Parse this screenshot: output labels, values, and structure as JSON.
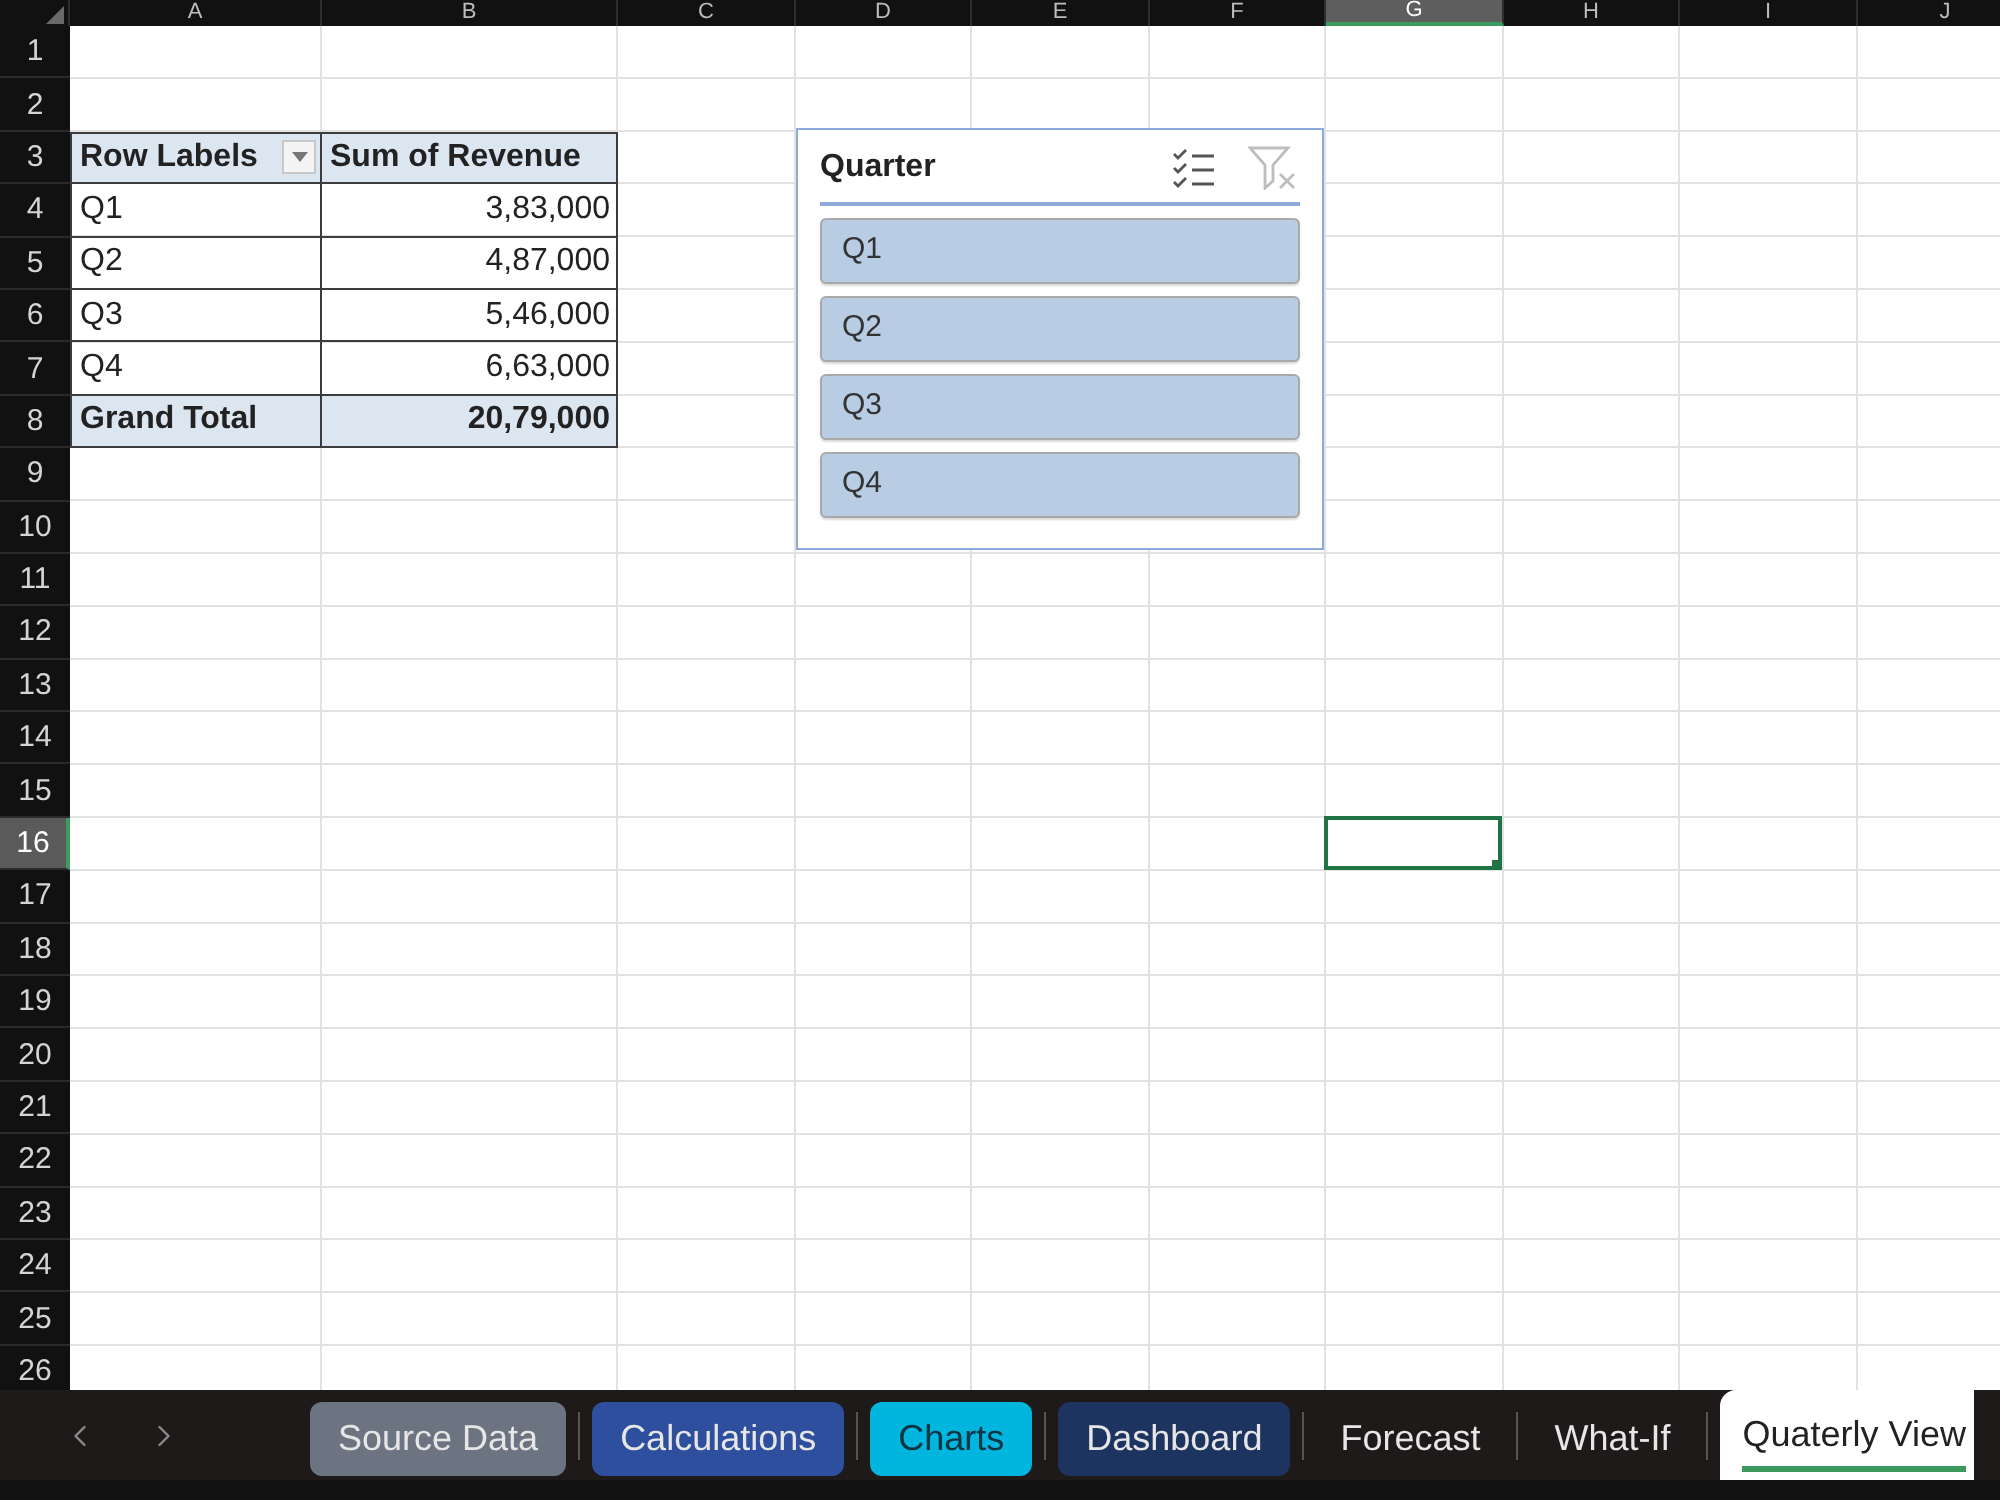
{
  "column_headers": [
    {
      "label": "A",
      "selected": false
    },
    {
      "label": "B",
      "selected": false
    },
    {
      "label": "C",
      "selected": false
    },
    {
      "label": "D",
      "selected": false
    },
    {
      "label": "E",
      "selected": false
    },
    {
      "label": "F",
      "selected": false
    },
    {
      "label": "G",
      "selected": true
    },
    {
      "label": "H",
      "selected": false
    },
    {
      "label": "I",
      "selected": false
    },
    {
      "label": "J",
      "selected": false
    }
  ],
  "row_headers": [
    {
      "label": "1",
      "selected": false
    },
    {
      "label": "2",
      "selected": false
    },
    {
      "label": "3",
      "selected": false
    },
    {
      "label": "4",
      "selected": false
    },
    {
      "label": "5",
      "selected": false
    },
    {
      "label": "6",
      "selected": false
    },
    {
      "label": "7",
      "selected": false
    },
    {
      "label": "8",
      "selected": false
    },
    {
      "label": "9",
      "selected": false
    },
    {
      "label": "10",
      "selected": false
    },
    {
      "label": "11",
      "selected": false
    },
    {
      "label": "12",
      "selected": false
    },
    {
      "label": "13",
      "selected": false
    },
    {
      "label": "14",
      "selected": false
    },
    {
      "label": "15",
      "selected": false
    },
    {
      "label": "16",
      "selected": true
    },
    {
      "label": "17",
      "selected": false
    },
    {
      "label": "18",
      "selected": false
    },
    {
      "label": "19",
      "selected": false
    },
    {
      "label": "20",
      "selected": false
    },
    {
      "label": "21",
      "selected": false
    },
    {
      "label": "22",
      "selected": false
    },
    {
      "label": "23",
      "selected": false
    },
    {
      "label": "24",
      "selected": false
    },
    {
      "label": "25",
      "selected": false
    },
    {
      "label": "26",
      "selected": false
    }
  ],
  "pivot_table": {
    "columns": [
      "Row Labels",
      "Sum of Revenue"
    ],
    "rows": [
      {
        "label": "Q1",
        "value": "3,83,000"
      },
      {
        "label": "Q2",
        "value": "4,87,000"
      },
      {
        "label": "Q3",
        "value": "5,46,000"
      },
      {
        "label": "Q4",
        "value": "6,63,000"
      }
    ],
    "total": {
      "label": "Grand Total",
      "value": "20,79,000"
    }
  },
  "slicer": {
    "title": "Quarter",
    "clear_filter_disabled": true,
    "items": [
      {
        "label": "Q1",
        "selected": true
      },
      {
        "label": "Q2",
        "selected": true
      },
      {
        "label": "Q3",
        "selected": true
      },
      {
        "label": "Q4",
        "selected": true
      }
    ]
  },
  "sheet_tabs": [
    {
      "label": "Source Data",
      "color": "#6b7480",
      "selected": false
    },
    {
      "label": "Calculations",
      "color": "#2e4f9e",
      "selected": false
    },
    {
      "label": "Charts",
      "color": "#00b5de",
      "selected": false
    },
    {
      "label": "Dashboard",
      "color": "#1d3461",
      "selected": false
    },
    {
      "label": "Forecast",
      "selected": false
    },
    {
      "label": "What-If",
      "selected": false
    },
    {
      "label": "Quaterly View",
      "selected": true
    }
  ]
}
